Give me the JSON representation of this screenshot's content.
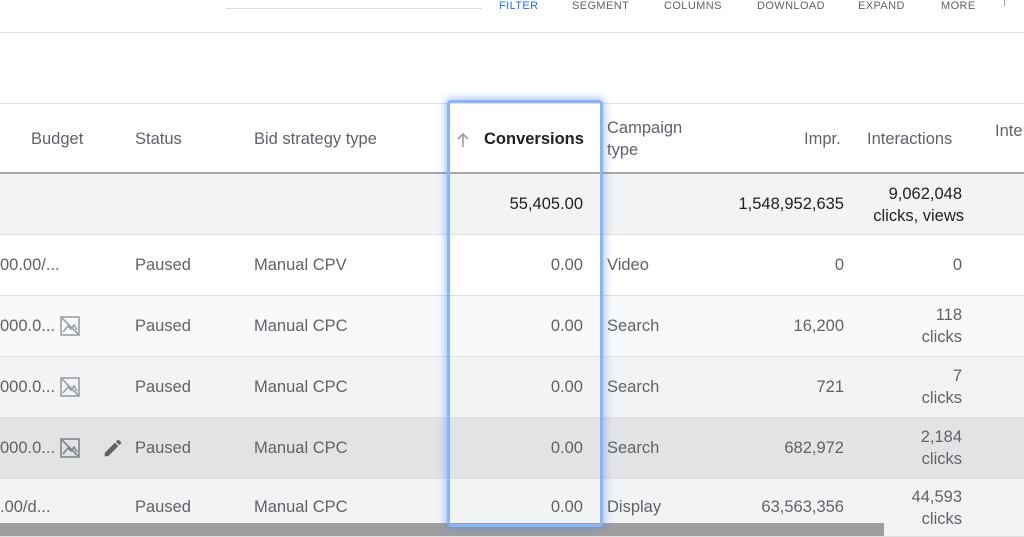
{
  "toolbar": {
    "filter": "FILTER",
    "segment": "SEGMENT",
    "columns": "COLUMNS",
    "download": "DOWNLOAD",
    "expand": "EXPAND",
    "more": "MORE"
  },
  "table": {
    "headers": {
      "budget": "Budget",
      "status": "Status",
      "bid_strategy_type": "Bid strategy type",
      "conversions": "Conversions",
      "campaign_type_line1": "Campaign",
      "campaign_type_line2": "type",
      "impr": "Impr.",
      "interactions": "Interactions",
      "next_partial": "Inte"
    },
    "total": {
      "conversions": "55,405.00",
      "impr": "1,548,952,635",
      "interactions_line1": "9,062,048",
      "interactions_line2": "clicks, views"
    },
    "rows": [
      {
        "budget": "00.00/...",
        "status": "Paused",
        "bid_strategy": "Manual CPV",
        "conversions": "0.00",
        "campaign_type": "Video",
        "impr": "0",
        "interactions_line1": "0",
        "interactions_line2": ""
      },
      {
        "budget": "000.0...",
        "status": "Paused",
        "bid_strategy": "Manual CPC",
        "conversions": "0.00",
        "campaign_type": "Search",
        "impr": "16,200",
        "interactions_line1": "118",
        "interactions_line2": "clicks"
      },
      {
        "budget": "000.0...",
        "status": "Paused",
        "bid_strategy": "Manual CPC",
        "conversions": "0.00",
        "campaign_type": "Search",
        "impr": "721",
        "interactions_line1": "7",
        "interactions_line2": "clicks"
      },
      {
        "budget": "000.0...",
        "status": "Paused",
        "bid_strategy": "Manual CPC",
        "conversions": "0.00",
        "campaign_type": "Search",
        "impr": "682,972",
        "interactions_line1": "2,184",
        "interactions_line2": "clicks"
      },
      {
        "budget": ".00/d...",
        "status": "Paused",
        "bid_strategy": "Manual CPC",
        "conversions": "0.00",
        "campaign_type": "Display",
        "impr": "63,563,356",
        "interactions_line1": "44,593",
        "interactions_line2": "clicks"
      }
    ]
  },
  "icons": {
    "no_image": "image-not-supported-icon",
    "edit": "pencil-icon",
    "sort": "arrow-up-icon"
  },
  "colors": {
    "accent": "#1a73e8",
    "highlight": "#8ab4f8"
  }
}
